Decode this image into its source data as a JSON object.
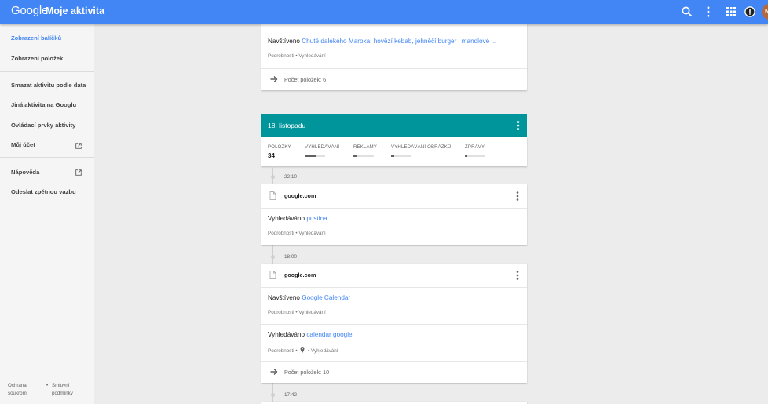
{
  "header": {
    "logo": "Google",
    "title": "Moje aktivita",
    "account_initial": "N"
  },
  "sidebar": {
    "items": [
      {
        "label": "Zobrazení balíčků"
      },
      {
        "label": "Zobrazení položek"
      },
      {
        "label": "Smazat aktivitu podle data"
      },
      {
        "label": "Jiná aktivita na Googlu"
      },
      {
        "label": "Ovládací prvky aktivity"
      },
      {
        "label": "Můj účet"
      },
      {
        "label": "Nápověda"
      },
      {
        "label": "Odeslat zpětnou vazbu"
      }
    ],
    "footer": {
      "privacy_1": "Ochrana",
      "privacy_2": "soukromí",
      "bullet": "•",
      "terms_1": "Smluvní",
      "terms_2": "podmínky"
    }
  },
  "top_card": {
    "prefix": "Navštíveno",
    "link": "Chuté dalekého Maroka: hovězí kebab, jehněčí burger i mandlové ...",
    "details": "Podrobnosti",
    "sep": "•",
    "type": "Vyhledávání",
    "count": "Počet položek: 6"
  },
  "day": {
    "title": "18. listopadu",
    "stats": [
      {
        "label": "POLOŽKY",
        "value": "34"
      },
      {
        "label": "VYHLEDÁVÁNÍ",
        "fill": 0.55
      },
      {
        "label": "REKLAMY",
        "fill": 0.2
      },
      {
        "label": "VYHLEDÁVÁNÍ OBRÁZKŮ",
        "fill": 0.15
      },
      {
        "label": "ZPRÁVY",
        "fill": 0.1
      }
    ]
  },
  "timeline": [
    {
      "time": "22:10",
      "source": "google.com",
      "entries": [
        {
          "prefix": "Vyhledáváno",
          "link": "pustina",
          "details": "Podrobnosti",
          "sep": "•",
          "type": "Vyhledávání"
        }
      ]
    },
    {
      "time": "18:00",
      "source": "google.com",
      "entries": [
        {
          "prefix": "Navštíveno",
          "link": "Google Calendar",
          "details": "Podrobnosti",
          "sep": "•",
          "type": "Vyhledávání"
        },
        {
          "prefix": "Vyhledáváno",
          "link": "calendar google",
          "details": "Podrobnosti",
          "sep": "•",
          "type": "Vyhledávání"
        }
      ],
      "count": "Počet položek: 10"
    },
    {
      "time": "17:42"
    }
  ],
  "colors": {
    "header": "#4285f4",
    "day_header": "#00959a",
    "link": "#4285f4",
    "avatar": "#b5683a",
    "notification": "#212121"
  },
  "icons": {
    "search": "search-icon",
    "more": "more-vert-icon",
    "apps": "apps-grid-icon",
    "notifications": "notifications-icon",
    "external": "open-in-new-icon",
    "arrow": "arrow-forward-icon",
    "document": "document-icon",
    "location": "location-pin-icon"
  }
}
